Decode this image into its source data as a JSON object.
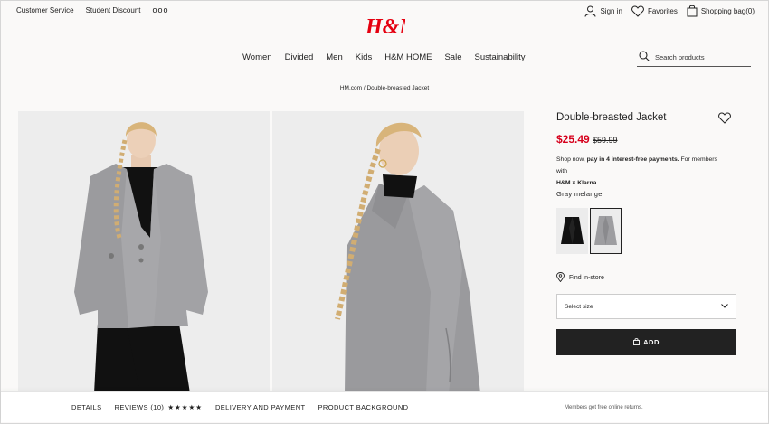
{
  "utility_bar": {
    "customer_service": "Customer Service",
    "student_discount": "Student Discount",
    "more": "ooo"
  },
  "brand": {
    "logo_text": "H&M",
    "logo_color": "#e50010"
  },
  "account": {
    "sign_in": "Sign in",
    "favorites": "Favorites",
    "shopping_bag": "Shopping bag(0)"
  },
  "nav": {
    "items": [
      "Women",
      "Divided",
      "Men",
      "Kids",
      "H&M HOME",
      "Sale",
      "Sustainability"
    ]
  },
  "search": {
    "placeholder": "Search products",
    "icon": "search-icon"
  },
  "breadcrumb": "HM.com / Double-breasted Jacket",
  "product": {
    "title": "Double-breasted Jacket",
    "price": "$25.49",
    "old_price": "$59.99",
    "price_color": "#d6001c",
    "klarna_prefix": "Shop now, ",
    "klarna_bold": "pay in 4 interest-free payments.",
    "klarna_suffix": " For members with",
    "klarna_brand": "H&M × Klarna.",
    "color_name": "Gray melange",
    "swatches": [
      "black",
      "gray-melange"
    ],
    "find_in_store": "Find in-store",
    "size_select": "Select size",
    "add_button": "ADD"
  },
  "bottom_tabs": {
    "details": "DETAILS",
    "reviews": "REVIEWS (10)",
    "stars": "★★★★★",
    "delivery": "DELIVERY AND PAYMENT",
    "background": "PRODUCT BACKGROUND",
    "returns_note": "Members get free online returns."
  }
}
